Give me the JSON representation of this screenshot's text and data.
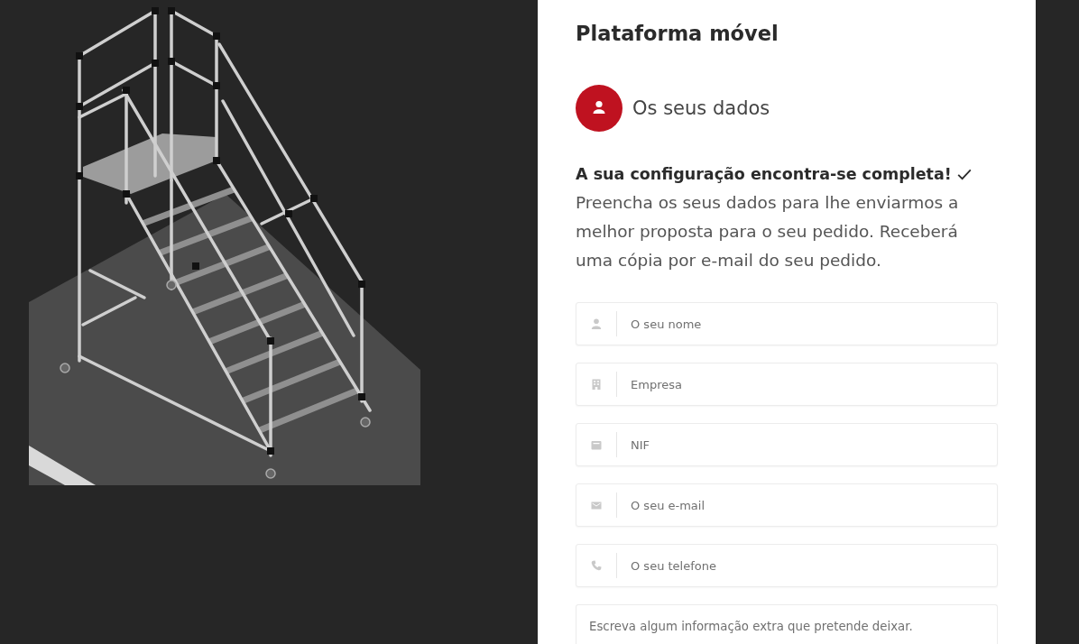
{
  "title": "Plataforma móvel",
  "step": {
    "label": "Os seus dados"
  },
  "summary": {
    "heading": "A sua configuração encontra-se completa!",
    "text": "Preencha os seus dados para lhe enviarmos a melhor proposta para o seu pedido. Receberá uma cópia por e-mail do seu pedido."
  },
  "form": {
    "fields": [
      {
        "kind": "person",
        "placeholder": "O seu nome"
      },
      {
        "kind": "building",
        "placeholder": "Empresa"
      },
      {
        "kind": "card",
        "placeholder": "NIF"
      },
      {
        "kind": "email",
        "placeholder": "O seu e-mail"
      },
      {
        "kind": "phone",
        "placeholder": "O seu telefone"
      },
      {
        "kind": "message",
        "placeholder": "Escreva algum informação extra que pretende deixar."
      }
    ]
  }
}
